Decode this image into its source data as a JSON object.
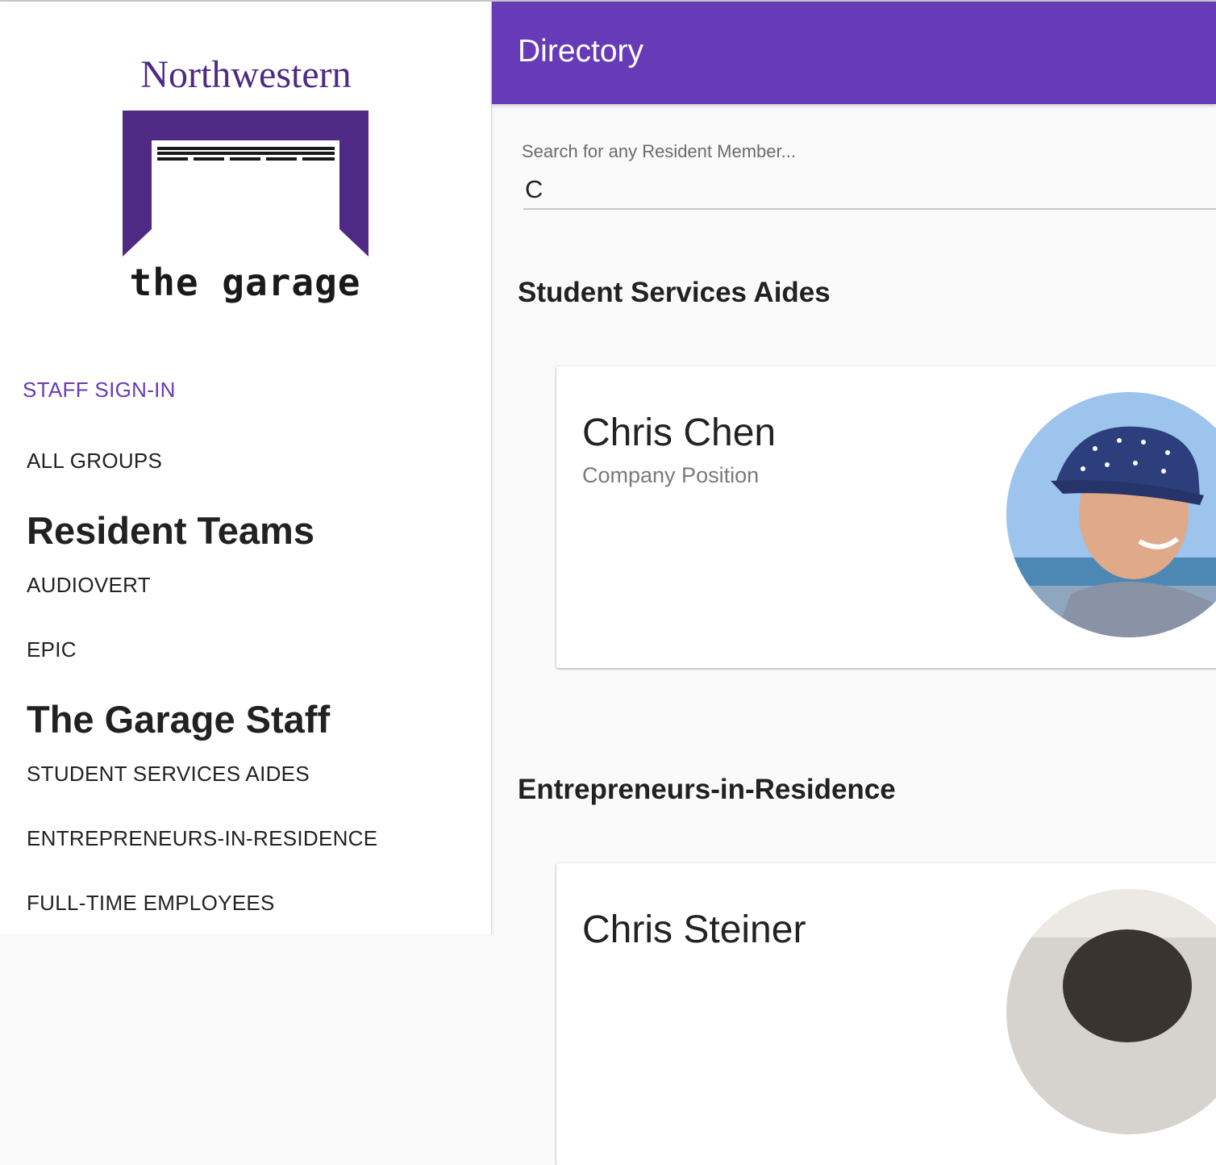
{
  "sidebar": {
    "logo": {
      "university": "Northwestern",
      "name": "the garage"
    },
    "staff_sign_in": "STAFF SIGN-IN",
    "all_groups": "ALL GROUPS",
    "resident_teams_heading": "Resident Teams",
    "resident_teams": [
      "AUDIOVERT",
      "EPIC"
    ],
    "staff_heading": "The Garage Staff",
    "staff_groups": [
      "STUDENT SERVICES AIDES",
      "ENTREPRENEURS-IN-RESIDENCE",
      "FULL-TIME EMPLOYEES"
    ]
  },
  "header": {
    "title": "Directory"
  },
  "search": {
    "label": "Search for any Resident Member...",
    "value": "C"
  },
  "sections": [
    {
      "title": "Student Services Aides",
      "cards": [
        {
          "name": "Chris Chen",
          "position": "Company Position"
        }
      ]
    },
    {
      "title": "Entrepreneurs-in-Residence",
      "cards": [
        {
          "name": "Chris Steiner",
          "position": ""
        }
      ]
    }
  ],
  "colors": {
    "brand_purple": "#673ab7",
    "logo_purple": "#4e2a84",
    "accent_link": "#6a3ab8"
  }
}
